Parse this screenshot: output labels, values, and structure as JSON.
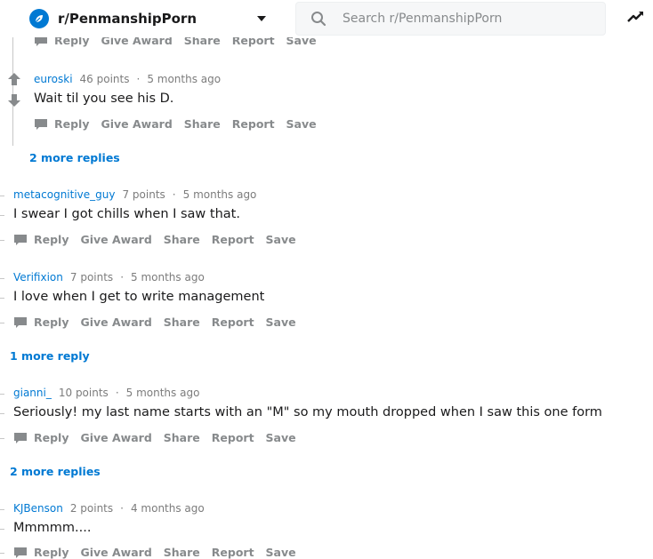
{
  "header": {
    "subreddit": "r/PenmanshipPorn",
    "search_placeholder": "Search r/PenmanshipPorn",
    "icons": {
      "subreddit": "subreddit-icon",
      "caret": "chevron-down-icon",
      "search": "search-icon",
      "trending": "trending-icon"
    }
  },
  "actions": {
    "reply": "Reply",
    "award": "Give Award",
    "share": "Share",
    "report": "Report",
    "save": "Save"
  },
  "comments": [
    {
      "author": "euroski",
      "points": "46 points",
      "time": "5 months ago",
      "body": "Wait til you see his D.",
      "nested": true
    },
    {
      "author": "metacognitive_guy",
      "points": "7 points",
      "time": "5 months ago",
      "body": "I swear I got chills when I saw that."
    },
    {
      "author": "Verifixion",
      "points": "7 points",
      "time": "5 months ago",
      "body": "I love when I get to write management"
    },
    {
      "author": "gianni_",
      "points": "10 points",
      "time": "5 months ago",
      "body": "Seriously! my last name starts with an \"M\" so my mouth dropped when I saw this one form"
    },
    {
      "author": "KJBenson",
      "points": "2 points",
      "time": "4 months ago",
      "body": "Mmmmm...."
    }
  ],
  "more_replies": [
    "2 more replies",
    "1 more reply",
    "2 more replies"
  ],
  "separator": "·"
}
